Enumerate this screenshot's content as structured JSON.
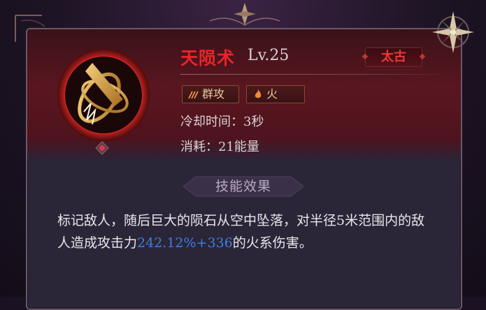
{
  "skill": {
    "name": "天陨术",
    "level": "Lv.25",
    "rarity": "太古",
    "tags": [
      {
        "label": "群攻",
        "icon": "aoe-icon"
      },
      {
        "label": "火",
        "icon": "fire-icon"
      }
    ],
    "cooldown": "冷却时间：3秒",
    "cost": "消耗：21能量"
  },
  "effect": {
    "title": "技能效果",
    "desc_before": "标记敌人，随后巨大的陨石从空中坠落，对半径5米范围内的敌人造成攻击力",
    "desc_value": "242.12%+336",
    "desc_after": "的火系伤害。"
  },
  "colors": {
    "name": "#e8242a",
    "highlight": "#3d7fe0",
    "rarity": "#e83a36"
  }
}
